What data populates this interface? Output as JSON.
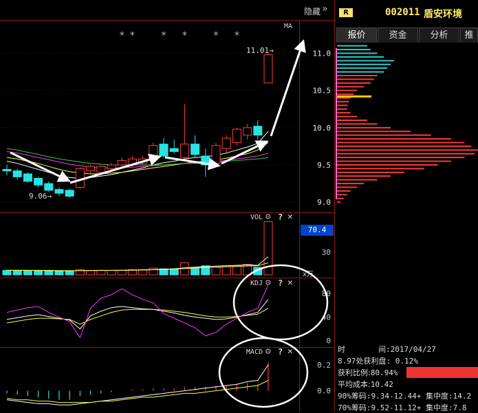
{
  "header": {
    "hide_label": "隐藏",
    "badge": "R",
    "stock_code": "002011",
    "stock_name": "盾安环境"
  },
  "tabs": [
    {
      "label": "报价"
    },
    {
      "label": "资金"
    },
    {
      "label": "分析"
    },
    {
      "label": "推"
    }
  ],
  "info": {
    "time_label": "时",
    "time_sep": "间:",
    "date": "2017/04/27",
    "profit_line": "8.97处获利盘: 0.12%",
    "profit_ratio_label": "获利比例:",
    "profit_ratio": "80.94%",
    "avg_cost_label": "平均成本:",
    "avg_cost": "10.42",
    "chip90": "90%筹码:9.34-12.44+ 集中度:14.2",
    "chip70": "70%筹码:9.52-11.12+ 集中度:7.8"
  },
  "colors": {
    "up": "#ff3b3b",
    "down": "#27e3e3",
    "ma_white": "#ffffff",
    "ma_yellow": "#ffff33",
    "ma_magenta": "#ff33ff",
    "ma_green": "#33cc33",
    "accent_blue": "#0044cc",
    "stock_name": "#ffee66"
  },
  "chart_data": [
    {
      "type": "candlestick",
      "name": "price",
      "indicator_label": "MA",
      "marker_symbol": "*",
      "annotations": {
        "high": "11.01",
        "low": "9.06"
      },
      "ylim": [
        8.9,
        11.3
      ],
      "yticks": [
        "11.0",
        "10.5",
        "10.0",
        "9.5",
        "9.0"
      ],
      "ytick_values": [
        11.0,
        10.5,
        10.0,
        9.5,
        9.0
      ],
      "candles": [
        {
          "o": 9.44,
          "h": 9.5,
          "l": 9.36,
          "c": 9.42
        },
        {
          "o": 9.42,
          "h": 9.45,
          "l": 9.3,
          "c": 9.34
        },
        {
          "o": 9.38,
          "h": 9.4,
          "l": 9.26,
          "c": 9.28
        },
        {
          "o": 9.32,
          "h": 9.34,
          "l": 9.2,
          "c": 9.23
        },
        {
          "o": 9.25,
          "h": 9.28,
          "l": 9.14,
          "c": 9.16
        },
        {
          "o": 9.17,
          "h": 9.2,
          "l": 9.08,
          "c": 9.12
        },
        {
          "o": 9.16,
          "h": 9.18,
          "l": 9.06,
          "c": 9.08
        },
        {
          "o": 9.2,
          "h": 9.47,
          "l": 9.18,
          "c": 9.45
        },
        {
          "o": 9.42,
          "h": 9.5,
          "l": 9.38,
          "c": 9.48
        },
        {
          "o": 9.4,
          "h": 9.5,
          "l": 9.35,
          "c": 9.48
        },
        {
          "o": 9.45,
          "h": 9.52,
          "l": 9.42,
          "c": 9.5
        },
        {
          "o": 9.5,
          "h": 9.6,
          "l": 9.45,
          "c": 9.56
        },
        {
          "o": 9.5,
          "h": 9.62,
          "l": 9.48,
          "c": 9.58
        },
        {
          "o": 9.52,
          "h": 9.62,
          "l": 9.48,
          "c": 9.58
        },
        {
          "o": 9.58,
          "h": 9.8,
          "l": 9.55,
          "c": 9.76
        },
        {
          "o": 9.78,
          "h": 9.86,
          "l": 9.6,
          "c": 9.62
        },
        {
          "o": 9.72,
          "h": 9.84,
          "l": 9.65,
          "c": 9.68
        },
        {
          "o": 9.6,
          "h": 10.32,
          "l": 9.58,
          "c": 9.78
        },
        {
          "o": 9.78,
          "h": 9.9,
          "l": 9.6,
          "c": 9.64
        },
        {
          "o": 9.62,
          "h": 9.72,
          "l": 9.34,
          "c": 9.5
        },
        {
          "o": 9.52,
          "h": 9.8,
          "l": 9.48,
          "c": 9.76
        },
        {
          "o": 9.72,
          "h": 9.9,
          "l": 9.65,
          "c": 9.86
        },
        {
          "o": 9.8,
          "h": 10.0,
          "l": 9.76,
          "c": 9.98
        },
        {
          "o": 9.9,
          "h": 10.05,
          "l": 9.84,
          "c": 10.0
        },
        {
          "o": 10.02,
          "h": 10.1,
          "l": 9.84,
          "c": 9.9
        },
        {
          "o": 10.6,
          "h": 11.01,
          "l": 10.6,
          "c": 10.98
        }
      ],
      "star_candles": [
        11,
        12,
        15,
        17,
        20,
        22
      ],
      "ma_series": [
        {
          "values": [
            9.55,
            9.52,
            9.48,
            9.44,
            9.4,
            9.36,
            9.33,
            9.32,
            9.33,
            9.35,
            9.37,
            9.4,
            9.43,
            9.46,
            9.5,
            9.53,
            9.55,
            9.58,
            9.6,
            9.61,
            9.63,
            9.66,
            9.7,
            9.74,
            9.79,
            9.95
          ]
        },
        {
          "values": [
            9.6,
            9.58,
            9.55,
            9.52,
            9.48,
            9.44,
            9.41,
            9.39,
            9.38,
            9.38,
            9.39,
            9.4,
            9.42,
            9.44,
            9.46,
            9.48,
            9.5,
            9.52,
            9.54,
            9.55,
            9.57,
            9.59,
            9.62,
            9.65,
            9.7,
            9.8
          ]
        },
        {
          "values": [
            9.68,
            9.66,
            9.63,
            9.6,
            9.57,
            9.54,
            9.51,
            9.49,
            9.47,
            9.46,
            9.46,
            9.46,
            9.47,
            9.48,
            9.49,
            9.5,
            9.51,
            9.52,
            9.53,
            9.54,
            9.55,
            9.56,
            9.58,
            9.6,
            9.62,
            9.66
          ]
        },
        {
          "values": [
            9.72,
            9.7,
            9.67,
            9.64,
            9.61,
            9.58,
            9.56,
            9.54,
            9.52,
            9.51,
            9.5,
            9.5,
            9.5,
            9.5,
            9.5,
            9.5,
            9.51,
            9.52,
            9.52,
            9.53,
            9.54,
            9.55,
            9.56,
            9.57,
            9.58,
            9.6
          ]
        }
      ]
    },
    {
      "type": "bar",
      "name": "volume",
      "indicator_label": "VOL",
      "unit_label": "x万",
      "current_value_label": "70.4",
      "ylim": [
        0,
        80
      ],
      "yticks": [
        "30"
      ],
      "ytick_values": [
        30
      ],
      "values": [
        6,
        6,
        5,
        5,
        6,
        5,
        5,
        7,
        6,
        6,
        6,
        6,
        7,
        7,
        9,
        8,
        8,
        16,
        10,
        12,
        10,
        12,
        12,
        14,
        10,
        70.4
      ],
      "ma_series": [
        {
          "values": [
            6,
            6,
            6,
            5.6,
            5.6,
            5.4,
            5.4,
            5.6,
            5.8,
            6,
            6,
            6.2,
            6.4,
            6.6,
            7,
            7.6,
            8,
            9.4,
            10.2,
            11,
            11.6,
            12,
            12.6,
            13.2,
            12.6,
            24
          ]
        },
        {
          "values": [
            6,
            6,
            6,
            6,
            5.8,
            5.6,
            5.5,
            5.6,
            5.7,
            5.8,
            5.9,
            6,
            6.2,
            6.4,
            6.8,
            7.2,
            7.6,
            8.4,
            9,
            9.6,
            10.2,
            10.8,
            11.2,
            11.8,
            12,
            16
          ]
        }
      ]
    },
    {
      "type": "line",
      "name": "kdj",
      "indicator_label": "KDJ",
      "ylim": [
        -5,
        100
      ],
      "yticks": [
        "80",
        "40",
        "0"
      ],
      "ytick_values": [
        80,
        40,
        0
      ],
      "series": [
        {
          "values": [
            36,
            39,
            42,
            44,
            41,
            38,
            35,
            20,
            42,
            50,
            56,
            58,
            56,
            54,
            53,
            50,
            47,
            43,
            40,
            38,
            36,
            37,
            40,
            44,
            48,
            70
          ]
        },
        {
          "values": [
            30,
            33,
            36,
            38,
            38,
            37,
            36,
            28,
            36,
            42,
            48,
            52,
            53,
            53,
            53,
            52,
            50,
            48,
            45,
            42,
            40,
            40,
            41,
            43,
            45,
            55
          ]
        },
        {
          "values": [
            48,
            52,
            56,
            58,
            48,
            40,
            32,
            5,
            55,
            72,
            78,
            88,
            78,
            70,
            64,
            46,
            38,
            30,
            22,
            8,
            14,
            28,
            38,
            48,
            55,
            95
          ]
        }
      ]
    },
    {
      "type": "bar",
      "name": "macd",
      "indicator_label": "MACD",
      "ylim": [
        -0.14,
        0.3
      ],
      "yticks": [
        "0.2",
        "0.0"
      ],
      "ytick_values": [
        0.2,
        0.0
      ],
      "values": [
        -0.02,
        -0.03,
        -0.04,
        -0.05,
        -0.06,
        -0.07,
        -0.07,
        -0.04,
        -0.03,
        -0.02,
        -0.01,
        0.0,
        0.01,
        0.01,
        0.02,
        0.02,
        0.02,
        0.03,
        0.03,
        0.03,
        0.04,
        0.04,
        0.05,
        0.06,
        0.05,
        0.22
      ],
      "series": [
        {
          "values": [
            -0.07,
            -0.08,
            -0.09,
            -0.1,
            -0.1,
            -0.11,
            -0.11,
            -0.1,
            -0.09,
            -0.08,
            -0.07,
            -0.06,
            -0.05,
            -0.04,
            -0.03,
            -0.02,
            -0.01,
            0.0,
            0.01,
            0.02,
            0.03,
            0.04,
            0.05,
            0.07,
            0.08,
            0.2
          ]
        },
        {
          "values": [
            -0.06,
            -0.07,
            -0.07,
            -0.08,
            -0.08,
            -0.09,
            -0.09,
            -0.09,
            -0.09,
            -0.08,
            -0.08,
            -0.07,
            -0.06,
            -0.05,
            -0.05,
            -0.04,
            -0.03,
            -0.02,
            -0.02,
            -0.01,
            0.0,
            0.01,
            0.02,
            0.03,
            0.04,
            0.08
          ]
        }
      ]
    },
    {
      "type": "bar",
      "name": "chip_distribution",
      "orientation": "horizontal",
      "ylim": [
        8.9,
        11.3
      ],
      "yticks": [
        "11.0",
        "10.5",
        "10.0",
        "9.5",
        "9.0"
      ],
      "ytick_values": [
        11.0,
        10.5,
        10.0,
        9.5,
        9.0
      ],
      "avg_cost": 10.42,
      "bins": [
        11.2,
        11.1,
        11.05,
        11.0,
        10.95,
        10.9,
        10.85,
        10.8,
        10.75,
        10.7,
        10.65,
        10.6,
        10.55,
        10.5,
        10.45,
        10.4,
        10.35,
        10.3,
        10.25,
        10.2,
        10.15,
        10.1,
        10.05,
        10.0,
        9.95,
        9.9,
        9.85,
        9.8,
        9.75,
        9.7,
        9.65,
        9.6,
        9.55,
        9.5,
        9.45,
        9.4,
        9.35,
        9.3,
        9.25,
        9.2,
        9.15,
        9.1,
        9.05,
        9.0
      ],
      "values": [
        40,
        45,
        50,
        60,
        70,
        85,
        80,
        75,
        70,
        60,
        55,
        50,
        40,
        30,
        25,
        20,
        18,
        16,
        15,
        20,
        30,
        45,
        60,
        80,
        110,
        140,
        170,
        190,
        200,
        210,
        205,
        190,
        170,
        150,
        130,
        100,
        80,
        60,
        40,
        30,
        20,
        15,
        10,
        5
      ]
    }
  ]
}
